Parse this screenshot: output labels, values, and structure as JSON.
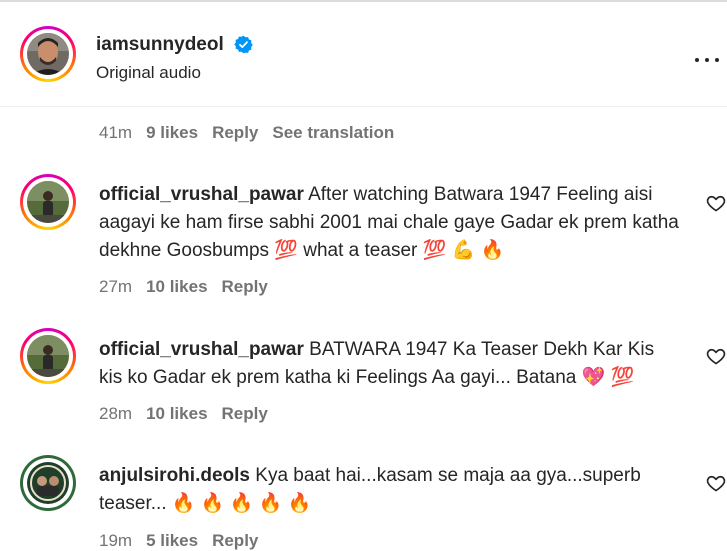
{
  "post": {
    "username": "iamsunnydeol",
    "audio": "Original audio",
    "meta": {
      "time": "41m",
      "likes": "9 likes",
      "reply": "Reply",
      "translate": "See translation"
    }
  },
  "comments": [
    {
      "username": "official_vrushal_pawar",
      "text": "After watching Batwara 1947 Feeling aisi aagayi ke ham firse sabhi 2001 mai chale gaye Gadar ek prem katha dekhne Goosbumps 💯  what a teaser 💯 💪 🔥",
      "time": "27m",
      "likes": "10 likes",
      "reply": "Reply"
    },
    {
      "username": "official_vrushal_pawar",
      "text": "BATWARA 1947 Ka Teaser Dekh Kar Kis kis ko Gadar ek prem katha ki Feelings Aa gayi... Batana 💖 💯",
      "time": "28m",
      "likes": "10 likes",
      "reply": "Reply"
    },
    {
      "username": "anjulsirohi.deols",
      "text": "Kya baat hai...kasam se maja aa gya...superb teaser... 🔥 🔥 🔥 🔥 🔥",
      "time": "19m",
      "likes": "5 likes",
      "reply": "Reply"
    }
  ],
  "colors": {
    "verified": "#0095f6",
    "secondary_text": "#737373",
    "text": "#262626"
  },
  "icons": [
    "verified-badge-icon",
    "more-options-icon",
    "heart-icon"
  ]
}
